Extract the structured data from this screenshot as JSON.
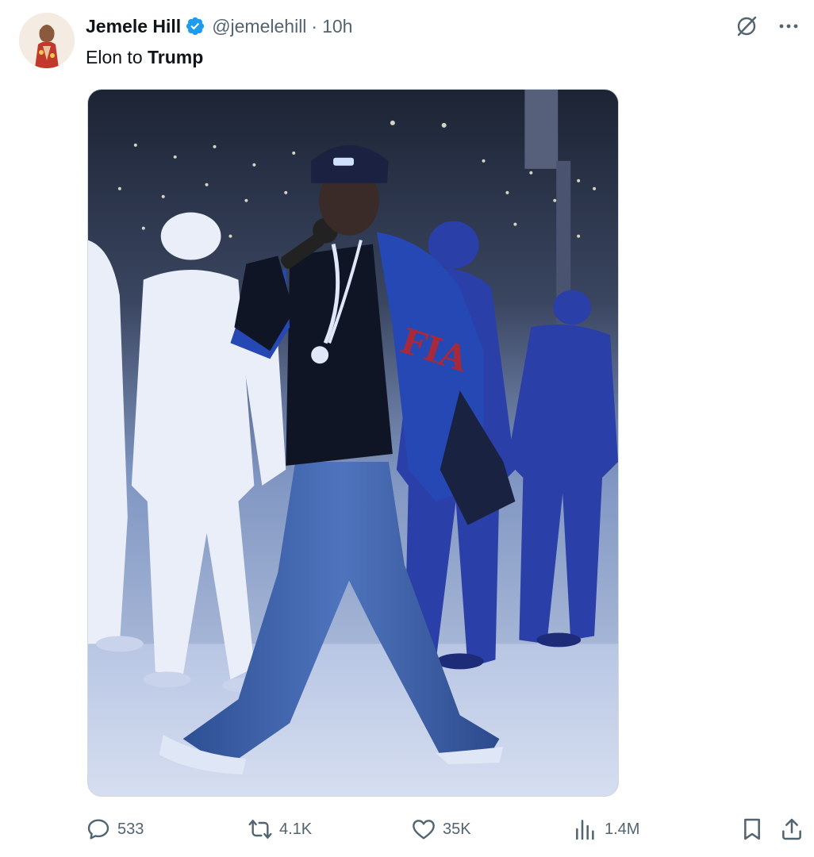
{
  "author": {
    "display_name": "Jemele Hill",
    "handle": "@jemelehill",
    "separator": "·",
    "time": "10h",
    "verified": true
  },
  "tweet": {
    "text_plain": "Elon to ",
    "text_bold": "Trump"
  },
  "media": {
    "alt": "Performer in blue jacket and jeans holding a microphone on a stage, backed by people in white and blue outfits"
  },
  "actions": {
    "replies": "533",
    "reposts": "4.1K",
    "likes": "35K",
    "views": "1.4M"
  },
  "icons": {
    "verified": "verified-badge-icon",
    "grok": "grok-icon",
    "more": "more-icon",
    "reply": "reply-icon",
    "repost": "repost-icon",
    "like": "heart-icon",
    "views": "views-icon",
    "bookmark": "bookmark-icon",
    "share": "share-icon"
  },
  "colors": {
    "text_primary": "#0f1419",
    "text_secondary": "#536471",
    "verified_blue": "#1d9bf0"
  }
}
